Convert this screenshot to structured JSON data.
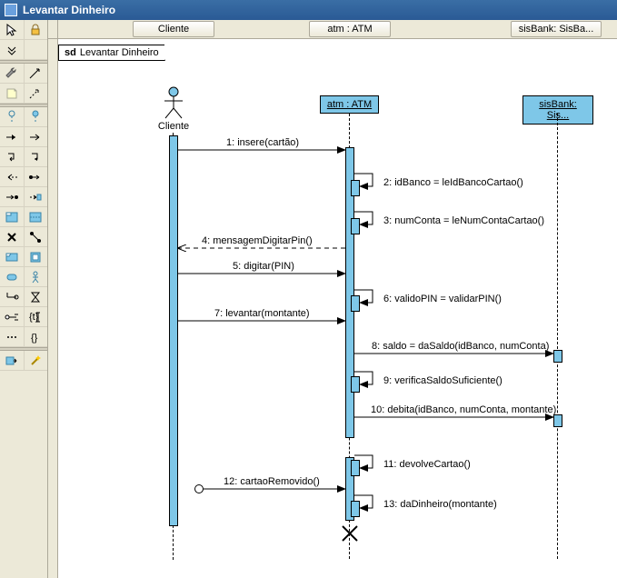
{
  "window": {
    "title": "Levantar Dinheiro"
  },
  "headers": {
    "cliente": "Cliente",
    "atm": "atm : ATM",
    "sisbank": "sisBank: SisBa..."
  },
  "frame": {
    "prefix": "sd",
    "name": "Levantar Dinheiro"
  },
  "lifelines": {
    "cliente": {
      "label": "Cliente"
    },
    "atm": {
      "label": "atm : ATM"
    },
    "sisbank": {
      "label": "sisBank: Sis..."
    }
  },
  "messages": {
    "m1": "1:  insere(cartão)",
    "m2": "2:  idBanco = leIdBancoCartao()",
    "m3": "3:  numConta = leNumContaCartao()",
    "m4": "4:  mensagemDigitarPin()",
    "m5": "5:  digitar(PIN)",
    "m6": "6:  validoPIN = validarPIN()",
    "m7": "7:  levantar(montante)",
    "m8": "8:  saldo = daSaldo(idBanco, numConta)",
    "m9": "9:  verificaSaldoSuficiente()",
    "m10": "10:  debita(idBanco, numConta, montante)",
    "m11": "11:  devolveCartao()",
    "m12": "12:  cartaoRemovido()",
    "m13": "13:  daDinheiro(montante)"
  }
}
